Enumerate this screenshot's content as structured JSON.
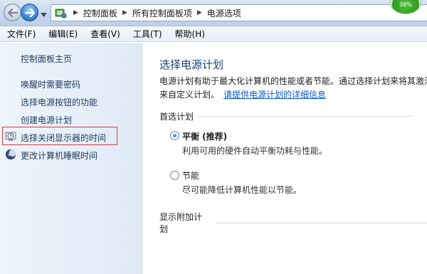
{
  "address_bar": {
    "breadcrumbs": [
      "控制面板",
      "所有控制面板项",
      "电源选项"
    ],
    "badge_text": "36%"
  },
  "menu": {
    "items": [
      "文件(F)",
      "编辑(E)",
      "查看(V)",
      "工具(T)",
      "帮助(H)"
    ]
  },
  "sidebar": {
    "home": "控制面板主页",
    "links": [
      "唤醒时需要密码",
      "选择电源按钮的功能",
      "创建电源计划",
      "选择关闭显示器的时间",
      "更改计算机睡眠时间"
    ],
    "highlight_color": "#d23a3a"
  },
  "main": {
    "title": "选择电源计划",
    "description_line1": "电源计划有助于最大化计算机的性能或者节能。通过选择计划来将其激活",
    "description_line2": "来自定义计划。",
    "description_link": "请提供电源计划的详细信息",
    "preferred_header": "首选计划",
    "plans": [
      {
        "name": "平衡 (推荐)",
        "description": "利用可用的硬件自动平衡功耗与性能。",
        "selected": true
      },
      {
        "name": "节能",
        "description": "尽可能降低计算机性能以节能。",
        "selected": false
      }
    ],
    "additional_header": "显示附加计划"
  },
  "colors": {
    "title_blue": "#1e3f7c",
    "link_blue": "#0a59c8",
    "sidebar_text": "#1e3a5f"
  }
}
